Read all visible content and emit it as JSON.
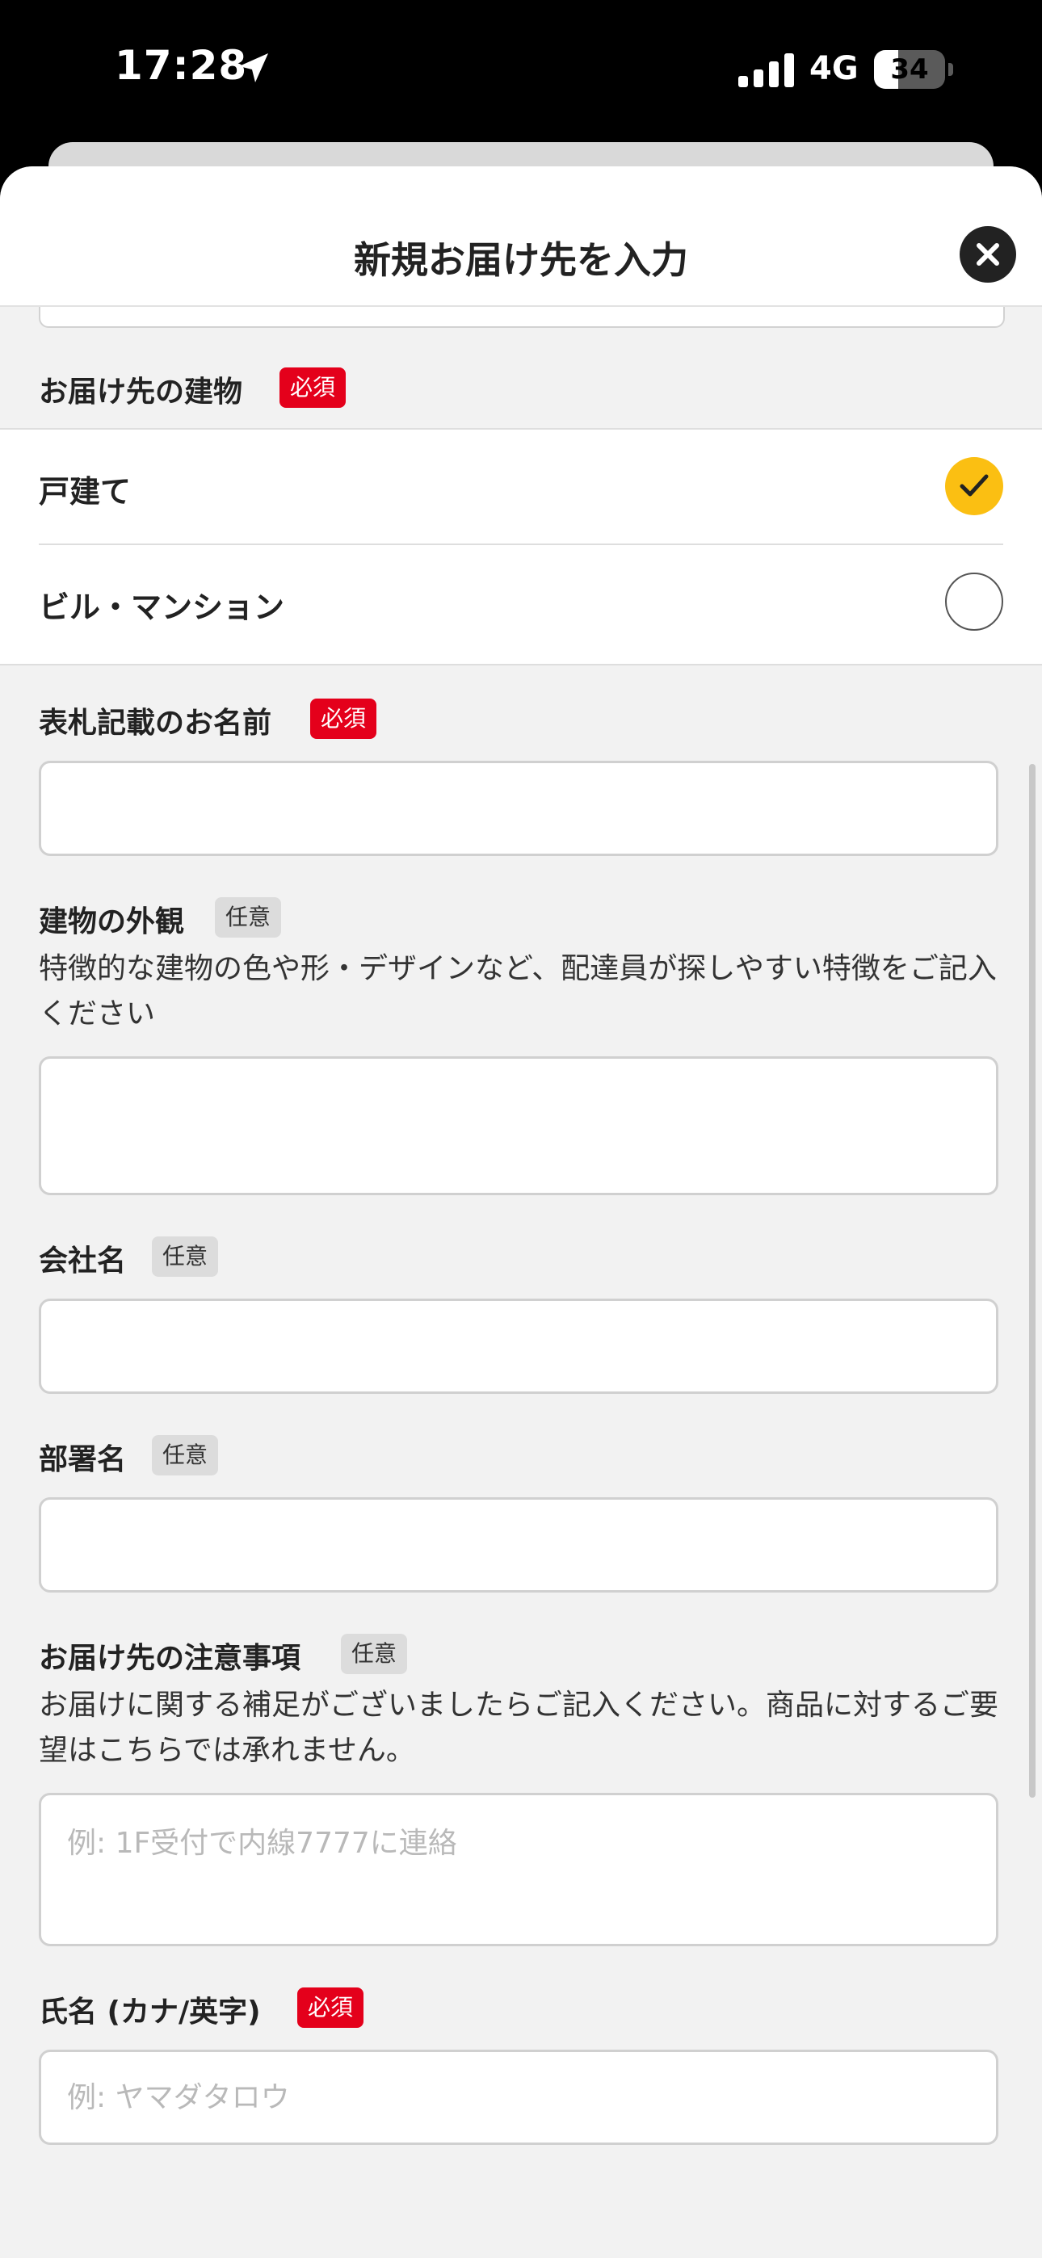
{
  "status_bar": {
    "time": "17:28",
    "network": "4G",
    "battery_percent": 34,
    "battery_label": "34"
  },
  "header": {
    "title": "新規お届け先を入力"
  },
  "building": {
    "label": "お届け先の建物",
    "badge": "必須",
    "options": [
      {
        "label": "戸建て",
        "selected": true
      },
      {
        "label": "ビル・マンション",
        "selected": false
      }
    ]
  },
  "nameplate": {
    "label": "表札記載のお名前",
    "badge": "必須",
    "value": ""
  },
  "exterior": {
    "label": "建物の外観",
    "badge": "任意",
    "description": "特徴的な建物の色や形・デザインなど、配達員が探しやすい特徴をご記入ください",
    "value": ""
  },
  "company": {
    "label": "会社名",
    "badge": "任意",
    "value": ""
  },
  "department": {
    "label": "部署名",
    "badge": "任意",
    "value": ""
  },
  "notes": {
    "label": "お届け先の注意事項",
    "badge": "任意",
    "description": "お届けに関する補足がございましたらご記入ください。商品に対するご要望はこちらでは承れません。",
    "placeholder": "例: 1F受付で内線7777に連絡",
    "value": ""
  },
  "kana_name": {
    "label": "氏名 (カナ/英字)",
    "badge": "必須",
    "placeholder": "例: ヤマダタロウ",
    "value": ""
  },
  "colors": {
    "required": "#e4001b",
    "optional": "#dcdcdc",
    "selected": "#fbbf12"
  },
  "icons": {
    "close": "close-icon",
    "check": "checkmark-icon",
    "location": "location-arrow-icon"
  }
}
